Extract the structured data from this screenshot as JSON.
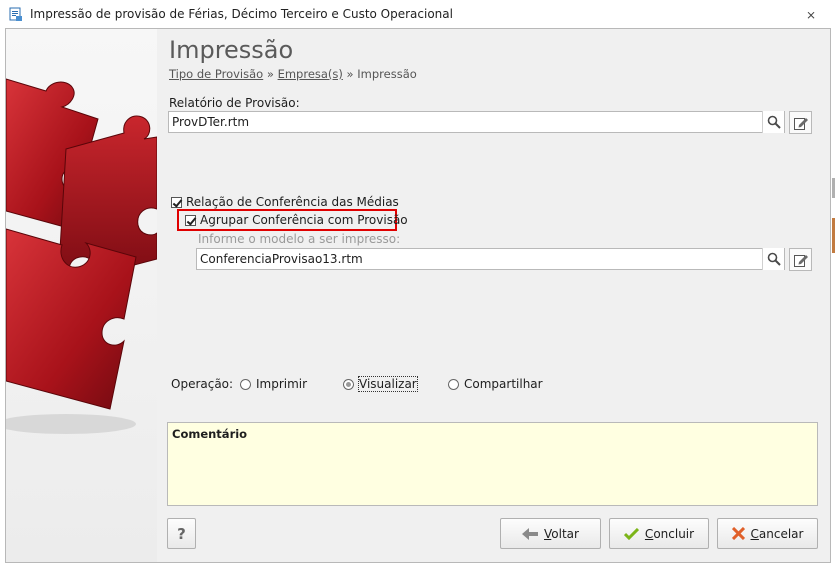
{
  "window": {
    "title": "Impressão de provisão de Férias, Décimo Terceiro e Custo Operacional",
    "close_glyph": "⨯"
  },
  "header": {
    "title": "Impressão",
    "breadcrumb": {
      "step1": "Tipo de Provisão",
      "sep1": " » ",
      "step2": "Empresa(s)",
      "sep2": " » ",
      "step3": "Impressão"
    }
  },
  "relatorio": {
    "label": "Relatório de Provisão:",
    "value": "ProvDTer.rtm"
  },
  "conferencia": {
    "checkbox_label": "Relação de Conferência das Médias",
    "checked": true,
    "agrupar_label": "Agrupar Conferência com Provisão",
    "agrupar_checked": true,
    "model_hint": "Informe o modelo a ser impresso:",
    "model_value": "ConferenciaProvisao13.rtm"
  },
  "operacao": {
    "label": "Operação:",
    "options": [
      "Imprimir",
      "Visualizar",
      "Compartilhar"
    ],
    "selected": "Visualizar"
  },
  "comment": {
    "title": "Comentário"
  },
  "footer": {
    "help_label": "?",
    "back_label": "Voltar",
    "finish_label": "Concluir",
    "cancel_label": "Cancelar"
  },
  "colors": {
    "highlight": "#e00000",
    "comment_bg": "#ffffe1",
    "puzzle_red": "#b3141c"
  },
  "icons": {
    "search": "magnifier-icon",
    "edit": "edit-icon",
    "back": "arrow-left-icon",
    "finish": "check-icon",
    "cancel": "x-icon"
  }
}
